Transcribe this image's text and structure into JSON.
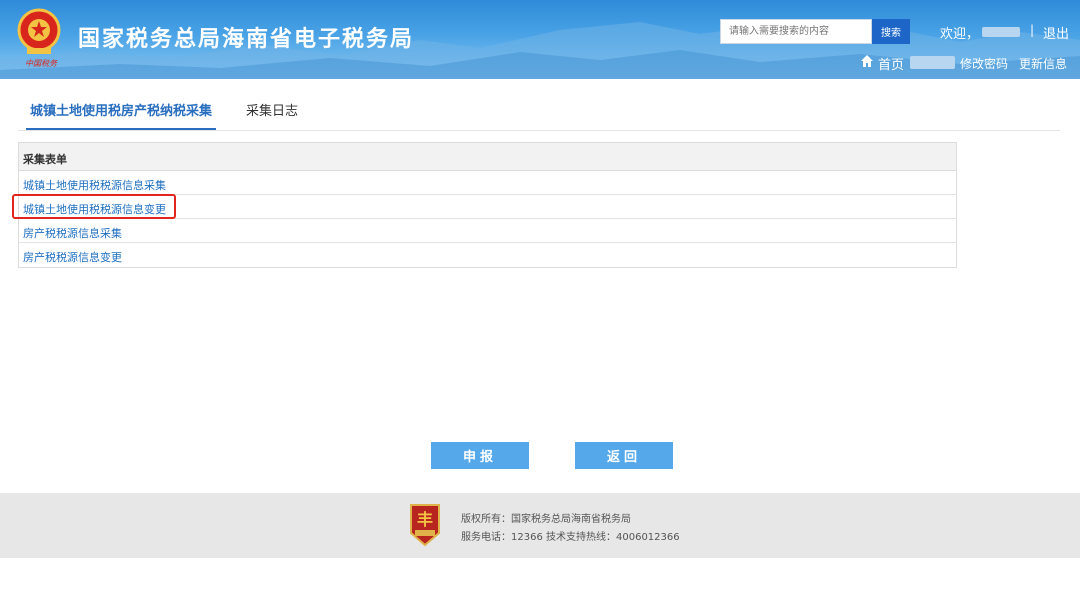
{
  "header": {
    "emblem_caption": "中国税务",
    "site_title": "国家税务总局海南省电子税务局",
    "search": {
      "placeholder": "请输入需要搜索的内容",
      "button_label": "搜索"
    },
    "welcome_label": "欢迎，",
    "separator": "|",
    "logout_label": "退出",
    "home_label": "首页",
    "change_password_label": "修改密码",
    "update_info_label": "更新信息"
  },
  "tabs": [
    {
      "label": "城镇土地使用税房产税纳税采集",
      "active": true
    },
    {
      "label": "采集日志",
      "active": false
    }
  ],
  "form_table": {
    "header": "采集表单",
    "rows": [
      "城镇土地使用税税源信息采集",
      "城镇土地使用税税源信息变更",
      "房产税税源信息采集",
      "房产税税源信息变更"
    ],
    "highlighted_row_index": 1
  },
  "actions": {
    "submit_label": "申报",
    "back_label": "返回"
  },
  "footer": {
    "copyright": "版权所有：国家税务总局海南省税务局",
    "contact": "服务电话：12366 技术支持热线：4006012366",
    "logo_caption": "税徽"
  },
  "colors": {
    "header_blue": "#2f8bd8",
    "link_blue": "#1f6fc0",
    "tab_active": "#2a6fbf",
    "button_blue": "#55a9eb",
    "highlight_red": "#e0261f",
    "footer_gray": "#e7e7e7"
  }
}
